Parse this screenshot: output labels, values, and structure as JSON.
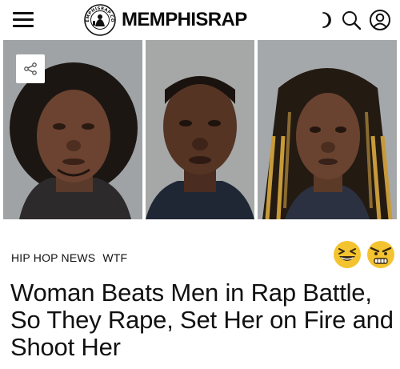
{
  "header": {
    "site_name": "MEMPHISRAP",
    "badge_text": "MEMPHISRAP.COM",
    "icons": [
      "menu-icon",
      "moon-icon",
      "search-icon",
      "user-icon"
    ]
  },
  "article": {
    "categories": [
      "HIP HOP NEWS",
      "WTF"
    ],
    "headline": "Woman Beats Men in Rap Battle, So They Rape, Set Her on Fire and Shoot Her",
    "reactions": [
      "laughing-emoji",
      "angry-emoji"
    ]
  },
  "colors": {
    "text": "#111111",
    "background": "#ffffff",
    "photo_bg": "#a0a3a4",
    "emoji_yellow": "#f4c430"
  }
}
